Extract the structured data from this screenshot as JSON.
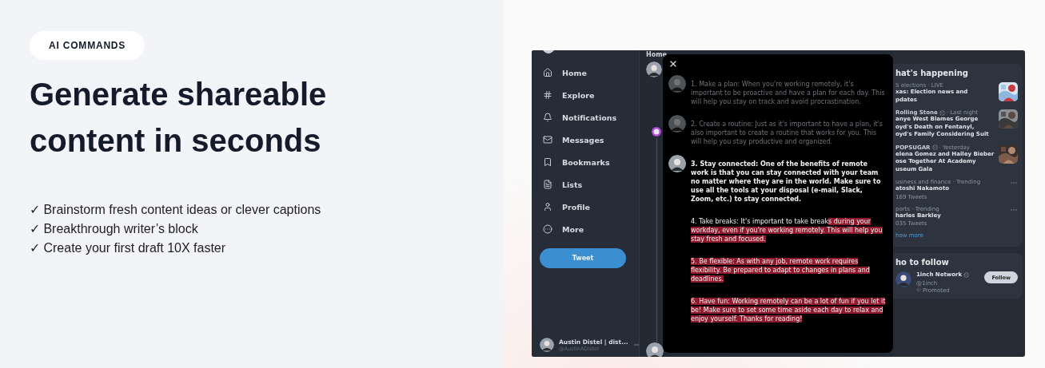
{
  "badge": "AI COMMANDS",
  "headline": "Generate shareable content in seconds",
  "features": [
    "✓ Brainstorm fresh content ideas or clever captions",
    "✓ Breakthrough writer’s block",
    "✓ Create your first draft 10X faster"
  ],
  "app": {
    "sidebar": {
      "items": [
        {
          "label": "Home"
        },
        {
          "label": "Explore"
        },
        {
          "label": "Notifications"
        },
        {
          "label": "Messages"
        },
        {
          "label": "Bookmarks"
        },
        {
          "label": "Lists"
        },
        {
          "label": "Profile"
        },
        {
          "label": "More"
        }
      ],
      "tweet_button": "Tweet",
      "account": {
        "name": "Austin Distel | dist...",
        "handle": "@AustinADistel"
      }
    },
    "feed": {
      "title": "Home"
    },
    "modal": {
      "items": [
        {
          "text": "1. Make a plan: When you're working remotely, it's important to be proactive and have a plan for each day. This will help you stay on track and avoid procrastination.",
          "dimmed": true,
          "avatar": true
        },
        {
          "text": "2. Create a routine: Just as it's important to have a plan, it's also important to create a routine that works for you. This will help you stay productive and organized.",
          "dimmed": true,
          "avatar": true
        },
        {
          "text": "3. Stay connected: One of the benefits of remote work is that you can stay connected with your team no matter where they are in the world. Make sure to use all the tools at your disposal (e-mail, Slack, Zoom, etc.) to stay connected.",
          "dimmed": false,
          "avatar": true
        },
        {
          "text": "4. Take breaks: It's important to take break",
          "highlight": "s during your workday, even if you're working remotely. This will help you stay fresh and focused.",
          "dimmed": false,
          "avatar": false
        },
        {
          "highlight": "5. Be flexible: As with any job, remote work requires flexibility. Be prepared to adapt to changes in plans and deadlines.",
          "dimmed": false,
          "avatar": false
        },
        {
          "highlight": "6. Have fun: Working remotely can be a lot of fun if you let it be! Make sure to set some time aside each day to relax and enjoy yourself. Thanks for reading!",
          "dimmed": false,
          "avatar": false
        }
      ]
    },
    "trends": {
      "title": "hat's happening",
      "items": [
        {
          "meta": "S elections · LIVE",
          "verified": false,
          "lines": [
            "xas: Election news and",
            "pdates"
          ]
        },
        {
          "meta": "Rolling Stone",
          "time": "· Last night",
          "verified": true,
          "lines": [
            "anye West Blames George",
            "oyd's Death on Fentanyl,",
            "oyd's Family Considering Suit"
          ]
        },
        {
          "meta": "POPSUGAR",
          "time": "· Yesterday",
          "verified": true,
          "lines": [
            "elena Gomez and Hailey Bieber",
            "ose Together At Academy",
            "useum Gala"
          ]
        },
        {
          "meta": "usiness and finance · Trending",
          "verified": false,
          "lines": [
            "atoshi Nakamoto"
          ],
          "count": "169 Tweets",
          "kind": "menu"
        },
        {
          "meta": "ports · Trending",
          "verified": false,
          "lines": [
            "harles Barkley"
          ],
          "count": "035 Tweets",
          "kind": "menu"
        }
      ],
      "show_more": "how more"
    },
    "follow": {
      "title": "ho to follow",
      "name": "1inch Network",
      "verified": true,
      "handle": "@1inch",
      "promoted": "Promoted",
      "button": "Follow"
    }
  }
}
